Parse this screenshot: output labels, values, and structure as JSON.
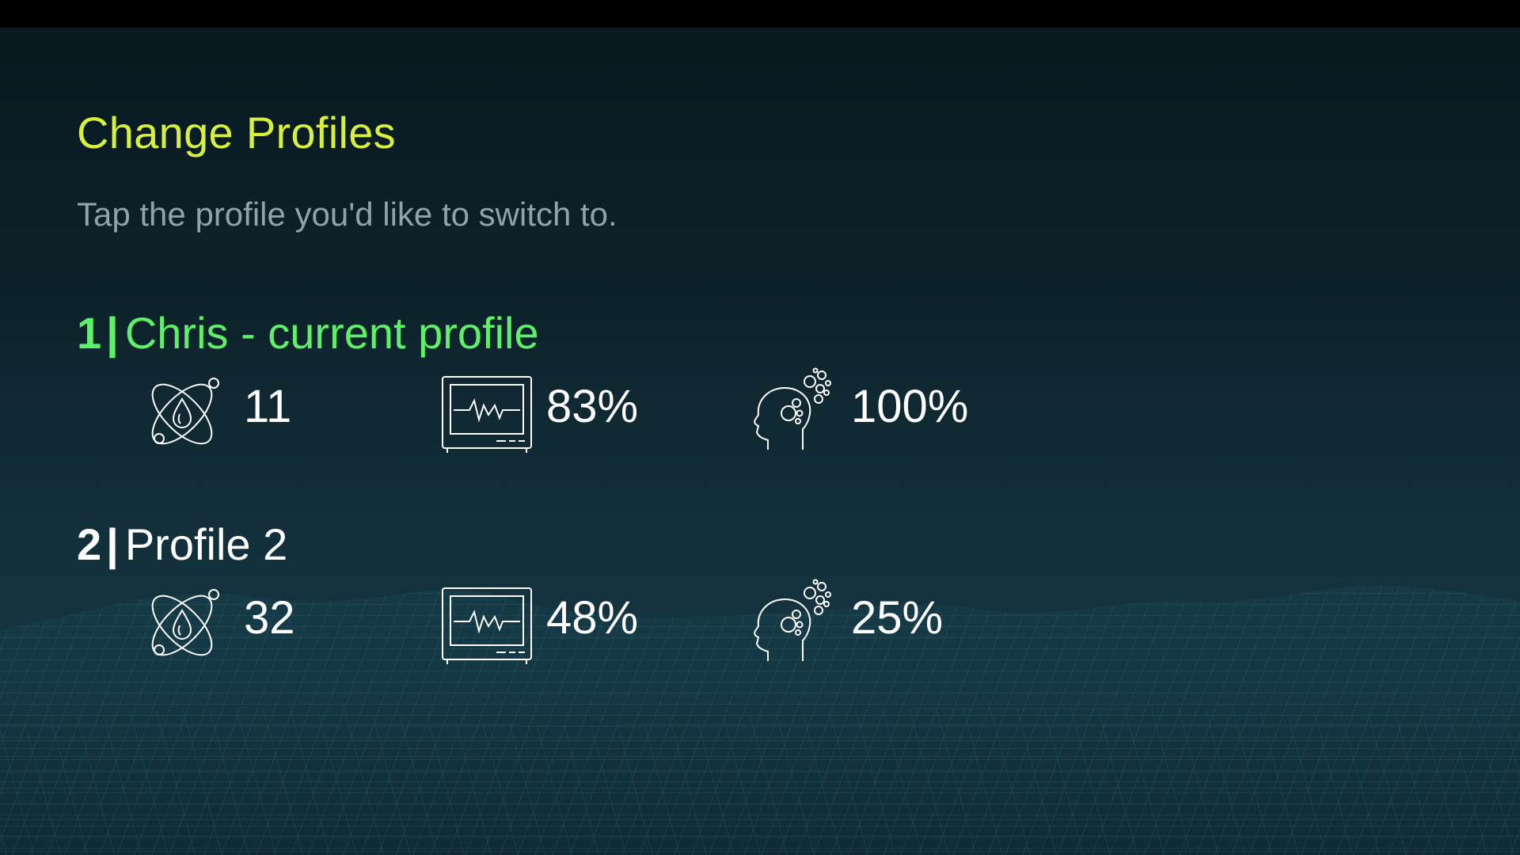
{
  "page": {
    "title": "Change Profiles",
    "subtitle": "Tap the profile you'd like to switch to."
  },
  "profiles": [
    {
      "number": "1",
      "separator": "|",
      "name": "Chris - current profile",
      "current": true,
      "stats": {
        "water": "11",
        "monitor": "83%",
        "mind": "100%"
      }
    },
    {
      "number": "2",
      "separator": "|",
      "name": "Profile 2",
      "current": false,
      "stats": {
        "water": "32",
        "monitor": "48%",
        "mind": "25%"
      }
    }
  ],
  "icons": {
    "water": "atom-droplet-icon",
    "monitor": "heart-monitor-icon",
    "mind": "head-bubbles-icon"
  },
  "colors": {
    "title": "#d8f03a",
    "current_profile": "#5ff06a",
    "other_profile": "#ffffff",
    "subtitle": "#8fa3aa",
    "background": "#0c2129"
  }
}
